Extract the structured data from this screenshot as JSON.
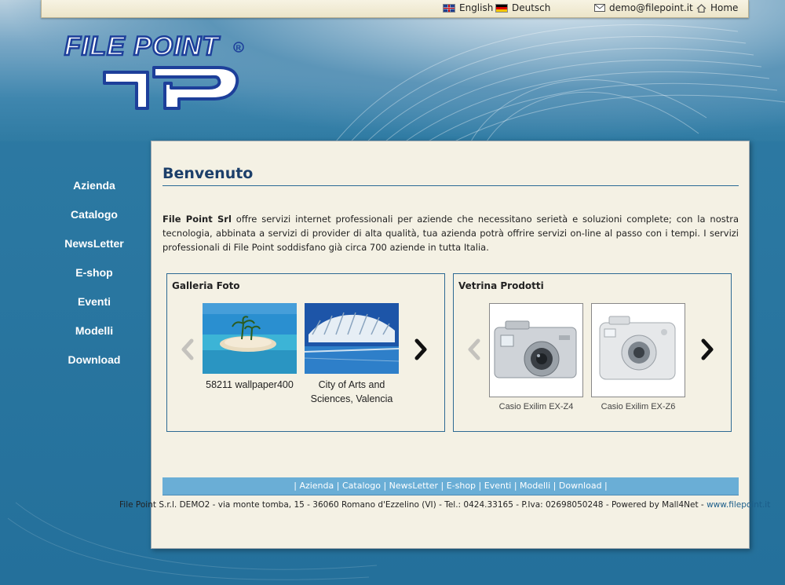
{
  "topbar": {
    "english": "English",
    "deutsch": "Deutsch",
    "email": "demo@filepoint.it",
    "home": "Home"
  },
  "logo": {
    "text": "FILE POINT",
    "mark": "FP"
  },
  "nav": [
    "Azienda",
    "Catalogo",
    "NewsLetter",
    "E-shop",
    "Eventi",
    "Modelli",
    "Download"
  ],
  "content": {
    "title": "Benvenuto",
    "intro_bold": "File Point Srl",
    "intro_rest": " offre servizi internet professionali per aziende che necessitano serietà e soluzioni complete; con la nostra tecnologia, abbinata a servizi di provider di alta qualità, tua azienda potrà offrire servizi on-line al passo con i tempi. I servizi professionali di File Point soddisfano già circa 700 aziende in tutta Italia."
  },
  "gallery": {
    "title": "Galleria Foto",
    "items": [
      {
        "caption": "58211 wallpaper400"
      },
      {
        "caption": "City of Arts and Sciences, Valencia"
      }
    ]
  },
  "products": {
    "title": "Vetrina Prodotti",
    "items": [
      {
        "caption": "Casio Exilim EX-Z4"
      },
      {
        "caption": "Casio Exilim EX-Z6"
      }
    ]
  },
  "footer": {
    "links": [
      "Azienda",
      "Catalogo",
      "NewsLetter",
      "E-shop",
      "Eventi",
      "Modelli",
      "Download"
    ],
    "address": "File Point S.r.l. DEMO2 - via monte tomba, 15 - 36060 Romano d'Ezzelino (VI) - Tel.: 0424.33165 - P.Iva: 02698050248 - Powered by Mall4Net - ",
    "site": "www.filepoint.it"
  },
  "colors": {
    "accent": "#2d6a93",
    "title": "#1c3f6a",
    "footbar": "#6aaed6",
    "panel": "#f4f1e4"
  }
}
